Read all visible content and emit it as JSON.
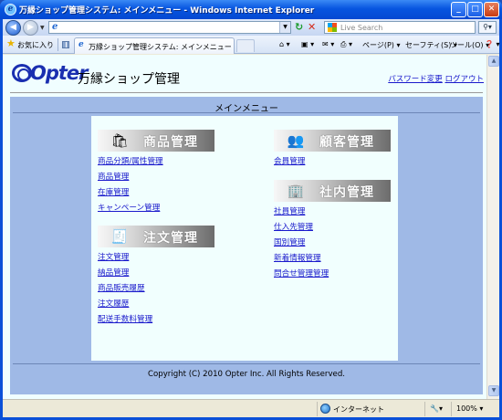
{
  "window": {
    "title": "万縁ショップ管理システム: メインメニュー - Windows Internet Explorer",
    "controls": {
      "minimize": "_",
      "maximize": "□",
      "close": "✕"
    }
  },
  "browser": {
    "address_value": "",
    "search_placeholder": "Live Search",
    "favorites_label": "お気に入り",
    "tab_label": "万縁ショップ管理システム: メインメニュー",
    "commands": {
      "page": "ページ(P) ▾",
      "safety": "セーフティ(S) ▾",
      "tools": "ツール(O) ▾",
      "help": "❓ ▾"
    },
    "status": {
      "zone": "インターネット",
      "zoom": "100% ▾"
    }
  },
  "page": {
    "shop_name": "万縁ショップ管理",
    "links": {
      "password_change": "パスワード変更",
      "logout": "ログアウト"
    },
    "menu_title": "メインメニュー",
    "sections": {
      "products": {
        "title": "商品管理",
        "icon": "products-icon",
        "items": [
          "商品分類/属性管理",
          "商品管理",
          "在庫管理",
          "キャンペーン管理"
        ]
      },
      "orders": {
        "title": "注文管理",
        "icon": "orders-icon",
        "items": [
          "注文管理",
          "納品管理",
          "商品販売履歴",
          "注文履歴",
          "配送手数料管理"
        ]
      },
      "customers": {
        "title": "顧客管理",
        "icon": "customers-icon",
        "items": [
          "会員管理"
        ]
      },
      "internal": {
        "title": "社内管理",
        "icon": "company-building-icon",
        "items": [
          "社員管理",
          "仕入先管理",
          "国別管理",
          "新着情報管理",
          "問合せ管理管理"
        ]
      }
    },
    "copyright": "Copyright (C) 2010 Opter Inc. All Rights Reserved."
  },
  "colors": {
    "link": "#1a1acc",
    "panel": "#9fb9e6",
    "content_bg": "#f0feff",
    "logo": "#1a2fb0"
  }
}
